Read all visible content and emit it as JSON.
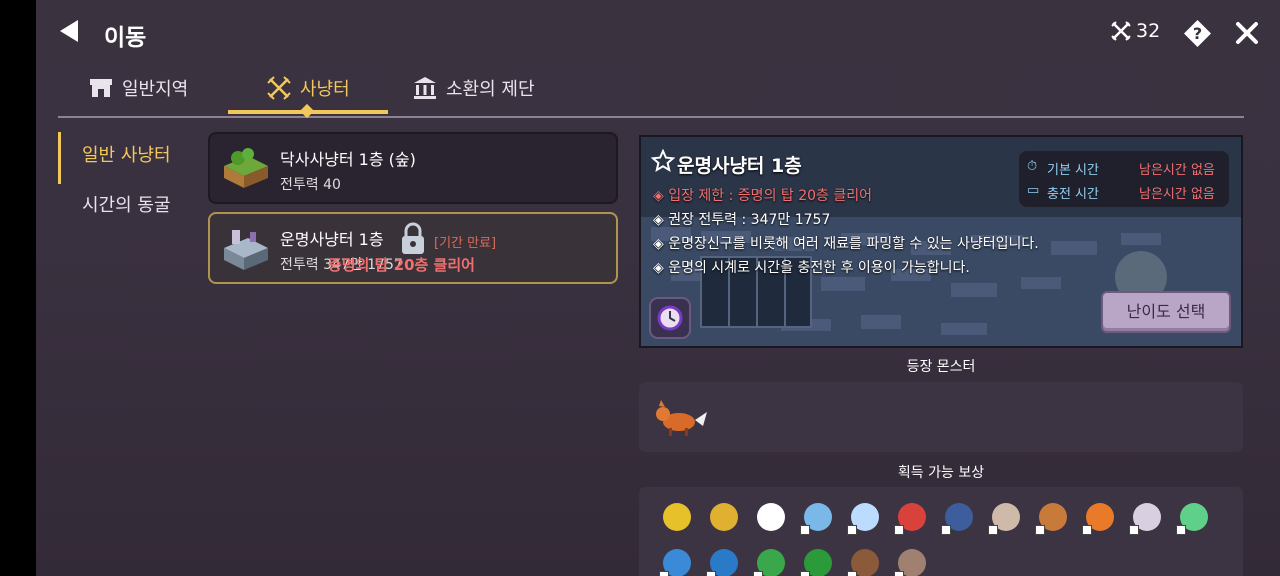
{
  "header": {
    "title": "이동",
    "combat_power": "32"
  },
  "tabs": [
    {
      "label": "일반지역",
      "icon": "shop-icon"
    },
    {
      "label": "사냥터",
      "icon": "crossed-swords-icon",
      "active": true
    },
    {
      "label": "소환의 제단",
      "icon": "temple-icon"
    }
  ],
  "sidebar": {
    "items": [
      {
        "label": "일반 사냥터",
        "active": true
      },
      {
        "label": "시간의 동굴"
      }
    ]
  },
  "hunting_grounds": [
    {
      "name": "닥사사냥터 1층 (숲)",
      "power": "전투력 40",
      "locked": false
    },
    {
      "name": "운명사냥터 1층",
      "power": "전투력 347만 1757",
      "tag": "[기간 만료]",
      "locked": true,
      "lock_message": "증명의 탑 20층 클리어"
    }
  ],
  "detail": {
    "name": "운명사냥터 1층",
    "restriction": "◈ 입장 제한 : 증명의 탑 20층 클리어",
    "recommended": "◈ 권장 전투력 : 347만 1757",
    "desc1": "◈ 운명장신구를 비롯해 여러 재료를 파밍할 수 있는 사냥터입니다.",
    "desc2": "◈ 운명의 시계로 시간을 충전한 후 이용이 가능합니다.",
    "base_time_label": "기본 시간",
    "base_time_value": "남은시간 없음",
    "charge_time_label": "충전 시간",
    "charge_time_value": "남은시간 없음",
    "difficulty_button": "난이도 선택"
  },
  "monsters_title": "등장 몬스터",
  "monsters": [
    {
      "icon": "fox-icon"
    }
  ],
  "rewards_title": "획득 가능 보상",
  "rewards": [
    {
      "icon": "gold-coin-icon",
      "color": "#e6c12a"
    },
    {
      "icon": "crown-icon",
      "color": "#e0b030"
    },
    {
      "icon": "crosshair-ring-icon",
      "color": "#ffffff"
    },
    {
      "icon": "fox-orb-icon",
      "color": "#7ab8e8"
    },
    {
      "icon": "blue-pearl-icon",
      "color": "#bcdcff"
    },
    {
      "icon": "red-gem-icon",
      "color": "#d9423a"
    },
    {
      "icon": "dark-ring-icon",
      "color": "#3d5d9c"
    },
    {
      "icon": "bone-icon",
      "color": "#cfb9a8"
    },
    {
      "icon": "box-icon",
      "color": "#c77a3a"
    },
    {
      "icon": "fire-orb-icon",
      "color": "#e87a2a"
    },
    {
      "icon": "clock-mirror-icon",
      "color": "#d8d0e0"
    },
    {
      "icon": "green-gem-icon",
      "color": "#5fd08a"
    },
    {
      "icon": "blue-swirl-icon",
      "color": "#3a8ad8"
    },
    {
      "icon": "blue-hook-icon",
      "color": "#2a7ac8"
    },
    {
      "icon": "green-swirl-icon",
      "color": "#3aa84a"
    },
    {
      "icon": "green-hook-icon",
      "color": "#2a9a3a"
    },
    {
      "icon": "brown-bag-icon",
      "color": "#8a5a3a"
    },
    {
      "icon": "chain-ring-icon",
      "color": "#a08070"
    }
  ]
}
